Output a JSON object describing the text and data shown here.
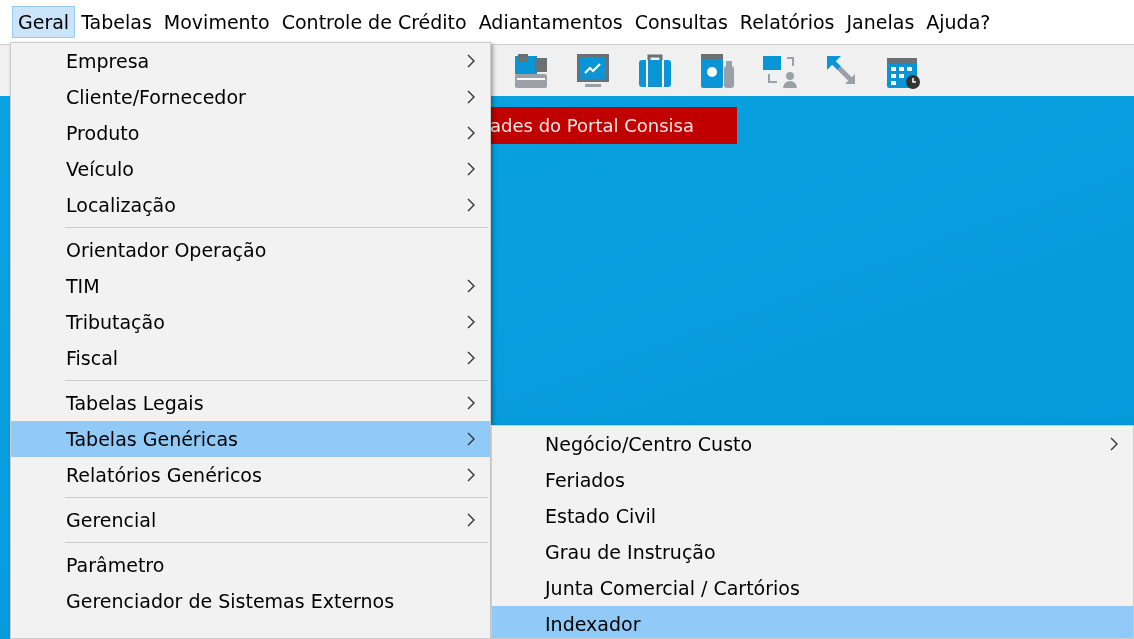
{
  "menubar": [
    {
      "label": "Geral",
      "selected": true
    },
    {
      "label": "Tabelas",
      "selected": false
    },
    {
      "label": "Movimento",
      "selected": false
    },
    {
      "label": "Controle de Crédito",
      "selected": false
    },
    {
      "label": "Adiantamentos",
      "selected": false
    },
    {
      "label": "Consultas",
      "selected": false
    },
    {
      "label": "Relatórios",
      "selected": false
    },
    {
      "label": "Janelas",
      "selected": false
    },
    {
      "label": "Ajuda?",
      "selected": false
    }
  ],
  "banner": {
    "text": "ades do Portal Consisa"
  },
  "main_menu": {
    "groups": [
      [
        {
          "label": "Empresa",
          "submenu": true,
          "selected": false
        },
        {
          "label": "Cliente/Fornecedor",
          "submenu": true,
          "selected": false
        },
        {
          "label": "Produto",
          "submenu": true,
          "selected": false
        },
        {
          "label": "Veículo",
          "submenu": true,
          "selected": false
        },
        {
          "label": "Localização",
          "submenu": true,
          "selected": false
        }
      ],
      [
        {
          "label": "Orientador Operação",
          "submenu": false,
          "selected": false
        },
        {
          "label": "TIM",
          "submenu": true,
          "selected": false
        },
        {
          "label": "Tributação",
          "submenu": true,
          "selected": false
        },
        {
          "label": "Fiscal",
          "submenu": true,
          "selected": false
        }
      ],
      [
        {
          "label": "Tabelas Legais",
          "submenu": true,
          "selected": false
        },
        {
          "label": "Tabelas Genéricas",
          "submenu": true,
          "selected": true
        },
        {
          "label": "Relatórios Genéricos",
          "submenu": true,
          "selected": false
        }
      ],
      [
        {
          "label": "Gerencial",
          "submenu": true,
          "selected": false
        }
      ],
      [
        {
          "label": "Parâmetro",
          "submenu": false,
          "selected": false
        },
        {
          "label": "Gerenciador de Sistemas Externos",
          "submenu": false,
          "selected": false
        }
      ]
    ]
  },
  "submenu": {
    "items": [
      {
        "label": "Negócio/Centro Custo",
        "submenu": true,
        "selected": false
      },
      {
        "label": "Feriados",
        "submenu": false,
        "selected": false
      },
      {
        "label": "Estado Civil",
        "submenu": false,
        "selected": false
      },
      {
        "label": "Grau de Instrução",
        "submenu": false,
        "selected": false
      },
      {
        "label": "Junta Comercial / Cartórios",
        "submenu": false,
        "selected": false
      },
      {
        "label": "Indexador",
        "submenu": false,
        "selected": true
      }
    ]
  }
}
